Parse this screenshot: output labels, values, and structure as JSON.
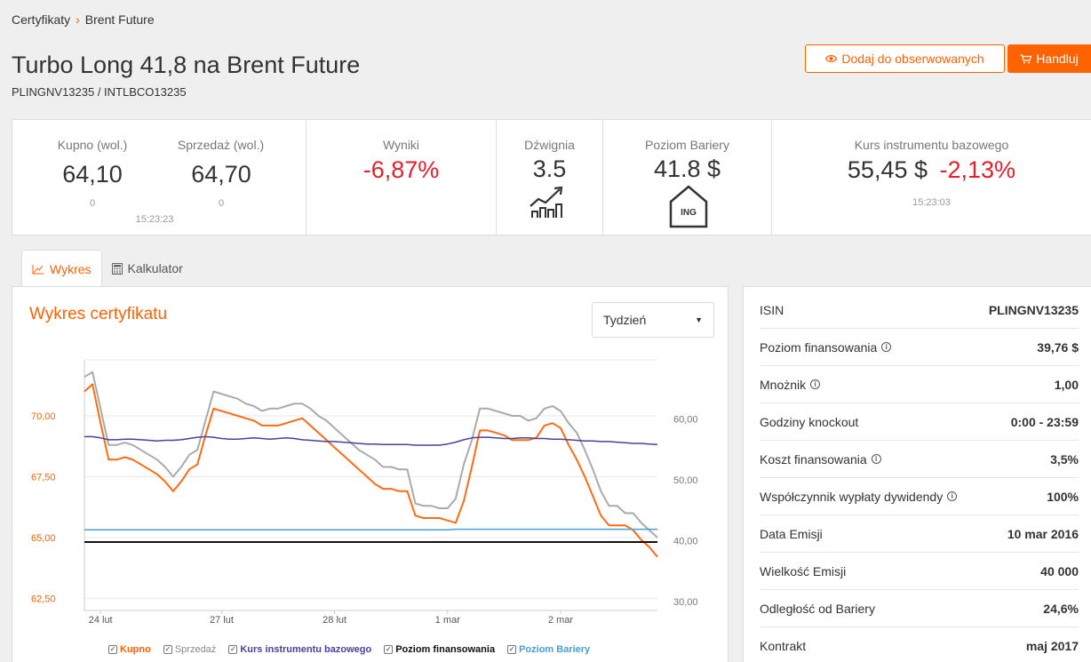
{
  "breadcrumb": {
    "parent": "Certyfikaty",
    "current": "Brent Future"
  },
  "header": {
    "title": "Turbo Long 41,8 na Brent Future",
    "subtitle": "PLINGNV13235 / INTLBCO13235",
    "watch_label": "Dodaj do obserwowanych",
    "trade_label": "Handluj"
  },
  "stats": {
    "buy_label": "Kupno (wol.)",
    "buy_value": "64,10",
    "buy_vol": "0",
    "sell_label": "Sprzedaż (wol.)",
    "sell_value": "64,70",
    "sell_vol": "0",
    "quote_time": "15:23:23",
    "results_label": "Wyniki",
    "results_value": "-6,87%",
    "leverage_label": "Dźwignia",
    "leverage_value": "3.5",
    "barrier_label": "Poziom Bariery",
    "barrier_value": "41.8 $",
    "barrier_logo": "ING",
    "underlying_label": "Kurs instrumentu bazowego",
    "underlying_value": "55,45 $",
    "underlying_change": "-2,13%",
    "underlying_time": "15:23:03"
  },
  "tabs": [
    {
      "label": "Wykres",
      "icon": "line-chart-icon",
      "active": true
    },
    {
      "label": "Kalkulator",
      "icon": "calculator-icon",
      "active": false
    }
  ],
  "chart_panel": {
    "title": "Wykres certyfikatu",
    "period": "Tydzień"
  },
  "colors": {
    "accent": "#ff6200",
    "kupno": "#ff6a13",
    "sprzedaz": "#aaaaaa",
    "underlying": "#4b3fa0",
    "financing": "#111111",
    "barrier": "#4a9fd8",
    "negative": "#e81e2b"
  },
  "chart_data": {
    "type": "line",
    "x": [
      0,
      1,
      2,
      3,
      4,
      5,
      6,
      7,
      8,
      9,
      10,
      11,
      12,
      13,
      14,
      15,
      16,
      17,
      18,
      19,
      20,
      21,
      22,
      23,
      24,
      25,
      26,
      27,
      28,
      29,
      30,
      31,
      32,
      33,
      34,
      35,
      36,
      37,
      38,
      39,
      40,
      41,
      42,
      43,
      44,
      45,
      46,
      47,
      48,
      49,
      50,
      51,
      52,
      53,
      54,
      55,
      56,
      57,
      58,
      59,
      60,
      61,
      62,
      63,
      64,
      65,
      66,
      67,
      68,
      69,
      70,
      71
    ],
    "xticks": [
      {
        "x": 2,
        "label": "24 lut"
      },
      {
        "x": 17,
        "label": "27 lut"
      },
      {
        "x": 31,
        "label": "28 lut"
      },
      {
        "x": 45,
        "label": "1 mar"
      },
      {
        "x": 59,
        "label": "2 mar"
      }
    ],
    "xlim": [
      0,
      71
    ],
    "y_left": {
      "ticks": [
        "70,00",
        "67,50",
        "65,00",
        "62,50"
      ],
      "tick_values": [
        70,
        67.5,
        65,
        62.5
      ],
      "ylim": [
        62,
        72.3
      ]
    },
    "y_right": {
      "ticks": [
        "60,00",
        "50,00",
        "40,00",
        "30,00"
      ],
      "tick_values": [
        60,
        50,
        40,
        30
      ],
      "ylim": [
        28.57,
        69.71
      ]
    },
    "series": [
      {
        "name": "Sprzedaż",
        "axis": "left",
        "values": [
          71.6,
          71.8,
          70.3,
          68.8,
          68.8,
          68.9,
          68.8,
          68.6,
          68.4,
          68.2,
          67.9,
          67.5,
          67.9,
          68.4,
          68.6,
          69.8,
          71.0,
          70.9,
          70.8,
          70.7,
          70.5,
          70.4,
          70.2,
          70.3,
          70.3,
          70.4,
          70.5,
          70.5,
          70.3,
          70.0,
          69.8,
          69.5,
          69.2,
          68.9,
          68.6,
          68.4,
          68.2,
          67.9,
          67.9,
          67.8,
          67.8,
          66.4,
          66.3,
          66.3,
          66.2,
          66.2,
          66.6,
          68.0,
          69.0,
          70.3,
          70.3,
          70.2,
          70.1,
          70.0,
          70.0,
          69.8,
          69.9,
          70.3,
          70.4,
          70.2,
          69.7,
          69.3,
          68.6,
          67.8,
          66.9,
          66.3,
          66.3,
          66.0,
          66.0,
          65.6,
          65.3,
          65.0
        ]
      },
      {
        "name": "Kupno",
        "axis": "left",
        "values": [
          71.0,
          71.3,
          69.7,
          68.2,
          68.2,
          68.3,
          68.2,
          68.0,
          67.8,
          67.6,
          67.3,
          66.9,
          67.3,
          67.8,
          68.0,
          69.2,
          70.3,
          70.2,
          70.1,
          70.0,
          69.9,
          69.8,
          69.6,
          69.6,
          69.6,
          69.7,
          69.8,
          69.9,
          69.6,
          69.3,
          69.0,
          68.7,
          68.4,
          68.1,
          67.8,
          67.5,
          67.2,
          67.0,
          67.0,
          66.9,
          66.9,
          65.9,
          65.8,
          65.8,
          65.8,
          65.7,
          65.6,
          66.5,
          67.9,
          69.4,
          69.4,
          69.3,
          69.2,
          69.0,
          69.0,
          69.0,
          69.1,
          69.6,
          69.7,
          69.5,
          68.8,
          68.2,
          67.5,
          66.7,
          65.9,
          65.5,
          65.5,
          65.5,
          65.3,
          64.9,
          64.6,
          64.2
        ]
      },
      {
        "name": "Kurs instrumentu bazowego",
        "axis": "right",
        "values": [
          57.1,
          57.1,
          56.9,
          56.6,
          56.6,
          56.7,
          56.7,
          56.6,
          56.5,
          56.4,
          56.5,
          56.5,
          56.6,
          56.8,
          57.0,
          57.1,
          57.0,
          56.8,
          56.7,
          56.7,
          56.8,
          56.9,
          56.8,
          56.7,
          56.8,
          56.9,
          56.8,
          56.6,
          56.5,
          56.4,
          56.3,
          56.3,
          56.2,
          56.1,
          56.0,
          55.9,
          55.9,
          55.8,
          55.8,
          55.8,
          55.8,
          55.7,
          55.7,
          55.7,
          55.7,
          55.9,
          56.2,
          56.6,
          56.9,
          57.0,
          57.0,
          56.9,
          56.8,
          56.8,
          56.9,
          56.9,
          56.8,
          56.8,
          56.7,
          56.7,
          56.6,
          56.5,
          56.4,
          56.4,
          56.3,
          56.3,
          56.2,
          56.1,
          56.0,
          56.0,
          55.9,
          55.8
        ]
      },
      {
        "name": "Poziom finansowania",
        "axis": "right",
        "values": [
          39.8,
          39.8,
          39.8,
          39.8,
          39.8,
          39.8,
          39.8,
          39.8,
          39.8,
          39.8,
          39.8,
          39.8,
          39.8,
          39.8,
          39.8,
          39.8,
          39.8,
          39.8,
          39.8,
          39.8,
          39.8,
          39.8,
          39.8,
          39.8,
          39.8,
          39.8,
          39.8,
          39.8,
          39.8,
          39.8,
          39.8,
          39.8,
          39.8,
          39.8,
          39.8,
          39.8,
          39.8,
          39.8,
          39.8,
          39.8,
          39.8,
          39.8,
          39.8,
          39.8,
          39.8,
          39.8,
          39.8,
          39.8,
          39.8,
          39.8,
          39.8,
          39.8,
          39.8,
          39.8,
          39.8,
          39.8,
          39.8,
          39.8,
          39.8,
          39.8,
          39.8,
          39.8,
          39.8,
          39.8,
          39.8,
          39.8,
          39.8,
          39.8,
          39.8,
          39.8,
          39.8,
          39.8
        ]
      },
      {
        "name": "Poziom Bariery",
        "axis": "right",
        "values": [
          41.8,
          41.8,
          41.8,
          41.8,
          41.8,
          41.8,
          41.8,
          41.8,
          41.8,
          41.8,
          41.8,
          41.8,
          41.8,
          41.8,
          41.8,
          41.8,
          41.8,
          41.8,
          41.8,
          41.8,
          41.8,
          41.8,
          41.8,
          41.8,
          41.8,
          41.8,
          41.8,
          41.8,
          41.8,
          41.8,
          41.8,
          41.8,
          41.8,
          41.8,
          41.8,
          41.8,
          41.8,
          41.8,
          41.8,
          41.8,
          41.8,
          41.8,
          41.8,
          41.8,
          41.8,
          41.8,
          41.9,
          41.9,
          41.9,
          41.9,
          41.9,
          41.9,
          41.9,
          41.9,
          41.9,
          41.9,
          41.9,
          41.9,
          41.9,
          41.9,
          41.9,
          41.9,
          41.9,
          41.9,
          41.9,
          41.9,
          41.9,
          41.9,
          41.9,
          41.9,
          41.9,
          41.9
        ]
      }
    ],
    "legend": [
      {
        "label": "Kupno",
        "color": "#ff6200",
        "bold": true
      },
      {
        "label": "Sprzedaż",
        "color": "#888888",
        "bold": false
      },
      {
        "label": "Kurs instrumentu bazowego",
        "color": "#4b3fa0",
        "bold": true
      },
      {
        "label": "Poziom finansowania",
        "color": "#111111",
        "bold": true
      },
      {
        "label": "Poziom Bariery",
        "color": "#4a9fd8",
        "bold": true
      }
    ],
    "grid": true,
    "legend_position": "bottom"
  },
  "info": [
    {
      "label": "ISIN",
      "value": "PLINGNV13235",
      "info": false
    },
    {
      "label": "Poziom finansowania",
      "value": "39,76 $",
      "info": true
    },
    {
      "label": "Mnożnik",
      "value": "1,00",
      "info": true
    },
    {
      "label": "Godziny knockout",
      "value": "0:00 - 23:59",
      "info": false
    },
    {
      "label": "Koszt finansowania",
      "value": "3,5%",
      "info": true
    },
    {
      "label": "Współczynnik wypłaty dywidendy",
      "value": "100%",
      "info": true
    },
    {
      "label": "Data Emisji",
      "value": "10 mar 2016",
      "info": false
    },
    {
      "label": "Wielkość Emisji",
      "value": "40 000",
      "info": false
    },
    {
      "label": "Odległość od Bariery",
      "value": "24,6%",
      "info": false
    },
    {
      "label": "Kontrakt",
      "value": "maj 2017",
      "info": false
    }
  ]
}
